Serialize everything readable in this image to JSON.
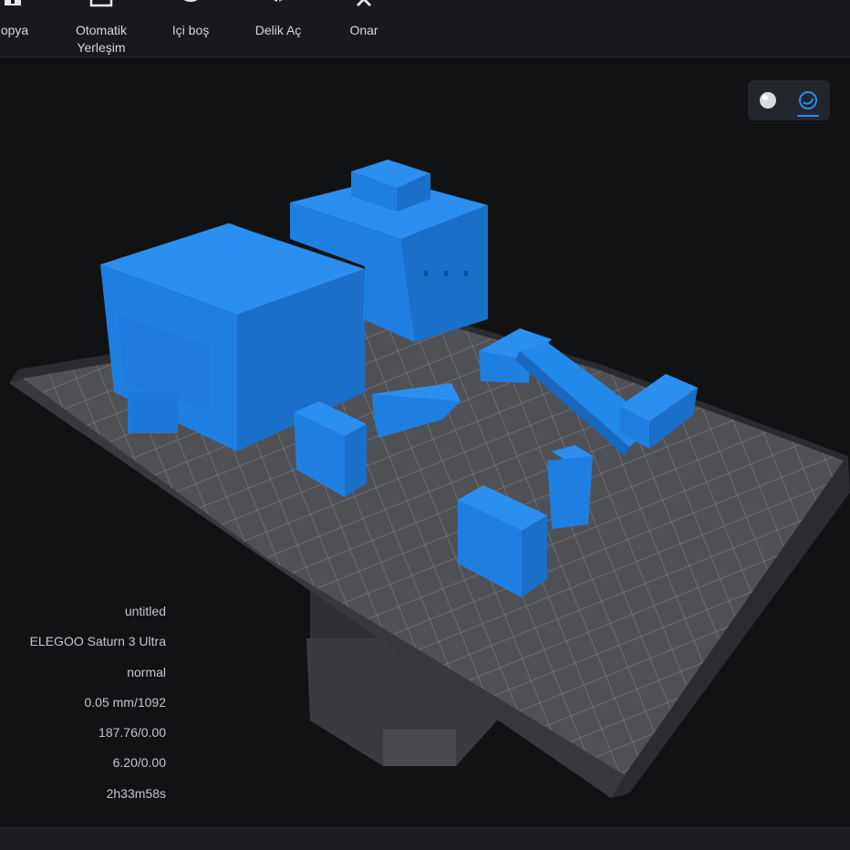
{
  "toolbar": {
    "items": [
      {
        "label": "opya",
        "icon": "copy-icon"
      },
      {
        "label": "Otomatik\nYerleşim",
        "icon": "auto-layout-icon"
      },
      {
        "label": "Içi boş",
        "icon": "hollow-icon"
      },
      {
        "label": "Delik Aç",
        "icon": "punch-hole-icon"
      },
      {
        "label": "Onar",
        "icon": "repair-icon"
      }
    ]
  },
  "view_modes": [
    {
      "icon": "solid-sphere-icon",
      "active": false
    },
    {
      "icon": "xray-sphere-icon",
      "active": true
    }
  ],
  "colors": {
    "accent": "#1e90ff",
    "model": "#1f7fe0",
    "plate": "#4e4f52",
    "background": "#111214"
  },
  "info": {
    "file_name": "untitled",
    "printer": "ELEGOO Saturn 3 Ultra",
    "profile": "normal",
    "layer": "0.05 mm/1092",
    "volume": "187.76/0.00",
    "weight": "6.20/0.00",
    "time": "2h33m58s"
  }
}
